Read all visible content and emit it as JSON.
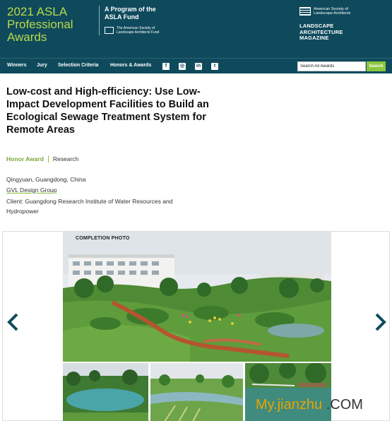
{
  "header": {
    "title_lines": [
      "2021 ASLA",
      "Professional",
      "Awards"
    ],
    "fund_lines": [
      "A Program of the",
      "ASLA Fund"
    ],
    "fund_logo_text": [
      "The American Society of",
      "Landscape Architects Fund"
    ],
    "asla_text": [
      "American Society of",
      "Landscape Architects"
    ],
    "magazine_lines": [
      "LANDSCAPE",
      "ARCHITECTURE",
      "MAGAZINE"
    ]
  },
  "nav": {
    "items": [
      "Winners",
      "Jury",
      "Selection Criteria",
      "Honors & Awards"
    ],
    "social_icons": [
      "facebook-icon",
      "instagram-icon",
      "linkedin-icon",
      "twitter-icon"
    ],
    "social_glyphs": [
      "f",
      "◎",
      "in",
      "t"
    ],
    "search_placeholder": "Search All Awards",
    "search_button": "Search"
  },
  "project": {
    "title": "Low-cost and High-efficiency: Use Low-Impact Development Facilities to Build an Ecological Sewage Treatment System for Remote Areas",
    "award": "Honor Award",
    "category": "Research",
    "location": "Qingyuan, Guangdong, China",
    "firm": "GVL Design Group",
    "client": "Client: Guangdong Research Institute of Water Resources and Hydropower"
  },
  "gallery": {
    "photo_label": "COMPLETION PHOTO"
  },
  "watermark": {
    "text": "My.jianzhu",
    "suffix": ".COM"
  },
  "colors": {
    "header_bg": "#0f4a5c",
    "accent_green": "#8cc63f",
    "title_green": "#b9d94a"
  }
}
